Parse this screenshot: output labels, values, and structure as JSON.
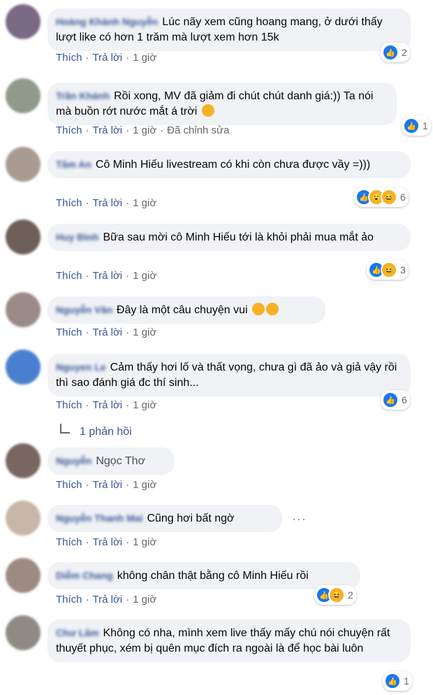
{
  "labels": {
    "like": "Thích",
    "reply": "Trả lời",
    "time": "1 giờ",
    "edited": "Đã chỉnh sửa",
    "sep": "·"
  },
  "comments": [
    {
      "name": "Hoàng Khánh Nguyễn",
      "text": "Lúc nãy xem cũng hoang mang, ở dưới thấy lượt like có hơn 1 trăm mà lượt xem hơn 15k",
      "reactions": "2"
    },
    {
      "name": "Trần Khánh",
      "text": "Rồi xong, MV đã giảm đi chút chút danh giá:)) Ta nói mà buồn rớt nước mắt á trời",
      "reactions": "1"
    },
    {
      "name": "Tâm An",
      "text": "Cô Minh Hiếu livestream có khi còn chưa được vầy =)))",
      "reactions": "6"
    },
    {
      "name": "Huy Đình",
      "text": "Bữa sau mời cô Minh Hiếu tới là khỏi phải mua mắt ảo",
      "reactions": "3"
    },
    {
      "name": "Nguyễn Văn",
      "text": "Đây là một câu chuyện vui"
    },
    {
      "name": "Nguyen Le",
      "text": "Cảm thấy hơi lố và thất vọng, chưa gì đã ảo và giả vậy rồi thì sao đánh giá đc thí sinh...",
      "reactions": "6"
    },
    {
      "name": "Ngọc Thơ",
      "blurred_name": "Nguyễn",
      "text": ""
    },
    {
      "name": "Nguyễn Thanh Mai",
      "text": "Cũng hơi bất ngờ"
    },
    {
      "name": "Diễm Chang",
      "text": "không chân thật bằng cô Minh Hiếu rồi",
      "reactions": "2"
    },
    {
      "name": "Chư Lâm",
      "text": "Không có nha, mình xem live thấy mấy chú nói chuyện rất thuyết phục, xém bị quên mục đích ra ngoài là để học bài luôn",
      "reactions": "1"
    }
  ],
  "replies_link": "1 phản hồi",
  "colors": {
    "link": "#385898",
    "bubble": "#f0f2f5",
    "like": "#1877f2",
    "haha": "#f7b125"
  }
}
